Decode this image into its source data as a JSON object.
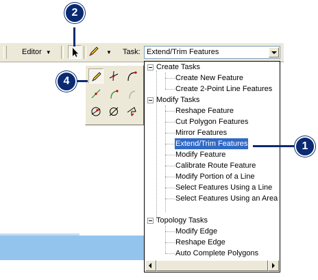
{
  "toolbar": {
    "editor_label": "Editor",
    "task_label": "Task:",
    "task_value": "Extend/Trim Features",
    "icons": [
      "edit-tool-arrow-icon",
      "sketch-pencil-icon"
    ]
  },
  "callouts": {
    "c1": "1",
    "c2": "2",
    "c4": "4"
  },
  "palette": {
    "tools": [
      "sketch-tool-icon",
      "intersection-tool-icon",
      "arc-tool-icon",
      "midpoint-tool-icon",
      "distance-distance-icon",
      "end-point-arc-icon",
      "direction-distance-icon",
      "intersection-circle-icon",
      "trace-tool-icon"
    ]
  },
  "task_tree": {
    "groups": [
      {
        "label": "Create Tasks",
        "items": [
          "Create New Feature",
          "Create 2-Point Line Features"
        ]
      },
      {
        "label": "Modify Tasks",
        "items": [
          "Reshape Feature",
          "Cut Polygon Features",
          "Mirror Features",
          "Extend/Trim Features",
          "Modify Feature",
          "Calibrate Route Feature",
          "Modify Portion of a Line",
          "Select Features Using a Line",
          "Select Features Using an Area"
        ]
      },
      {
        "label": "Topology Tasks",
        "items": [
          "Modify Edge",
          "Reshape Edge",
          "Auto Complete Polygons"
        ]
      }
    ],
    "selected": "Extend/Trim Features"
  },
  "colors": {
    "callout": "#0a2a72",
    "selection": "#316ac5",
    "toolbar": "#ece9d8",
    "background_band": "#93c4ed"
  }
}
